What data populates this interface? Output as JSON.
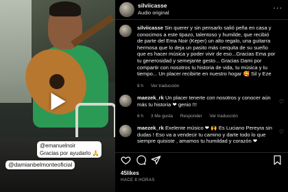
{
  "media": {
    "stickers": [
      {
        "line1": "@emanuelnoir",
        "line2": "Gracias por ayudarlo 🙏"
      },
      {
        "line1": "@damianbelmonteoficial"
      }
    ]
  },
  "header": {
    "username": "silviicasse",
    "subtitle": "Audio original",
    "more": "···"
  },
  "comments": [
    {
      "username": "silviicasse",
      "text": "Sin querer y sin pensarlo salió peña en casa y conocimos a este tipazo, talentoso y humilde, que recibió de parte del Ema Noir (Keper) un alto regalo, una guitarra hermosa que lo deja un pasito más cerquita de su sueño que es hacer música y poder vivir de eso...Gracias Ema por tu generosidad y semejante gesto... Gracias Dami por compartir con nosotros tu historia de vida, tu música y tu tiempo... Un placer recibirte en nuestro hogar 🥰 Sil y Eze",
      "time": "8 h",
      "translate": "Ver traducción"
    },
    {
      "username": "maezek_rk",
      "text": "Un placer tenerte con nosotros y conocer aún más tu historia ❤ genio !!!",
      "time": "6 h",
      "likes": "3 Me gusta",
      "reply": "Responder",
      "translate": "Ver traducción"
    },
    {
      "username": "maezek_rk",
      "text": "Exelente músico ❤ 🙌 Es Luciano Pereyra sin dudas ! Eso va a vendecir tu camino y darte todo lo que siempre quisiste , amamos tu humildad y corazón ❤"
    }
  ],
  "post": {
    "likes": "45likes",
    "ago": "HACE 8 HORAS"
  },
  "colors": {
    "like_red": "#ed4956",
    "secondary_text": "#a8a8a8",
    "divider": "#262626"
  }
}
